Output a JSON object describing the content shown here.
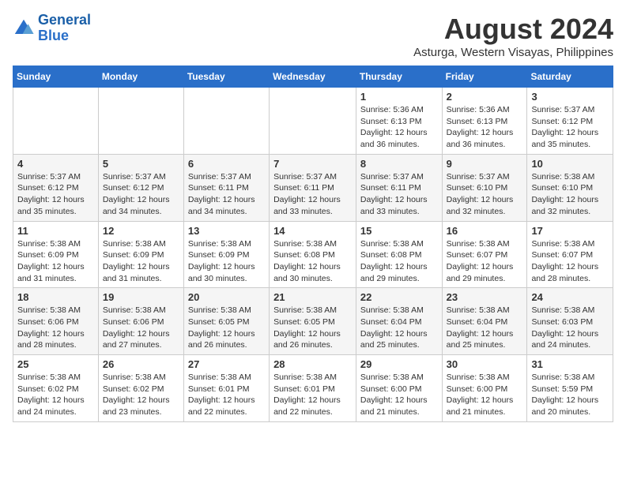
{
  "logo": {
    "line1": "General",
    "line2": "Blue"
  },
  "title": "August 2024",
  "location": "Asturga, Western Visayas, Philippines",
  "weekdays": [
    "Sunday",
    "Monday",
    "Tuesday",
    "Wednesday",
    "Thursday",
    "Friday",
    "Saturday"
  ],
  "weeks": [
    [
      {
        "day": "",
        "detail": ""
      },
      {
        "day": "",
        "detail": ""
      },
      {
        "day": "",
        "detail": ""
      },
      {
        "day": "",
        "detail": ""
      },
      {
        "day": "1",
        "detail": "Sunrise: 5:36 AM\nSunset: 6:13 PM\nDaylight: 12 hours\nand 36 minutes."
      },
      {
        "day": "2",
        "detail": "Sunrise: 5:36 AM\nSunset: 6:13 PM\nDaylight: 12 hours\nand 36 minutes."
      },
      {
        "day": "3",
        "detail": "Sunrise: 5:37 AM\nSunset: 6:12 PM\nDaylight: 12 hours\nand 35 minutes."
      }
    ],
    [
      {
        "day": "4",
        "detail": "Sunrise: 5:37 AM\nSunset: 6:12 PM\nDaylight: 12 hours\nand 35 minutes."
      },
      {
        "day": "5",
        "detail": "Sunrise: 5:37 AM\nSunset: 6:12 PM\nDaylight: 12 hours\nand 34 minutes."
      },
      {
        "day": "6",
        "detail": "Sunrise: 5:37 AM\nSunset: 6:11 PM\nDaylight: 12 hours\nand 34 minutes."
      },
      {
        "day": "7",
        "detail": "Sunrise: 5:37 AM\nSunset: 6:11 PM\nDaylight: 12 hours\nand 33 minutes."
      },
      {
        "day": "8",
        "detail": "Sunrise: 5:37 AM\nSunset: 6:11 PM\nDaylight: 12 hours\nand 33 minutes."
      },
      {
        "day": "9",
        "detail": "Sunrise: 5:37 AM\nSunset: 6:10 PM\nDaylight: 12 hours\nand 32 minutes."
      },
      {
        "day": "10",
        "detail": "Sunrise: 5:38 AM\nSunset: 6:10 PM\nDaylight: 12 hours\nand 32 minutes."
      }
    ],
    [
      {
        "day": "11",
        "detail": "Sunrise: 5:38 AM\nSunset: 6:09 PM\nDaylight: 12 hours\nand 31 minutes."
      },
      {
        "day": "12",
        "detail": "Sunrise: 5:38 AM\nSunset: 6:09 PM\nDaylight: 12 hours\nand 31 minutes."
      },
      {
        "day": "13",
        "detail": "Sunrise: 5:38 AM\nSunset: 6:09 PM\nDaylight: 12 hours\nand 30 minutes."
      },
      {
        "day": "14",
        "detail": "Sunrise: 5:38 AM\nSunset: 6:08 PM\nDaylight: 12 hours\nand 30 minutes."
      },
      {
        "day": "15",
        "detail": "Sunrise: 5:38 AM\nSunset: 6:08 PM\nDaylight: 12 hours\nand 29 minutes."
      },
      {
        "day": "16",
        "detail": "Sunrise: 5:38 AM\nSunset: 6:07 PM\nDaylight: 12 hours\nand 29 minutes."
      },
      {
        "day": "17",
        "detail": "Sunrise: 5:38 AM\nSunset: 6:07 PM\nDaylight: 12 hours\nand 28 minutes."
      }
    ],
    [
      {
        "day": "18",
        "detail": "Sunrise: 5:38 AM\nSunset: 6:06 PM\nDaylight: 12 hours\nand 28 minutes."
      },
      {
        "day": "19",
        "detail": "Sunrise: 5:38 AM\nSunset: 6:06 PM\nDaylight: 12 hours\nand 27 minutes."
      },
      {
        "day": "20",
        "detail": "Sunrise: 5:38 AM\nSunset: 6:05 PM\nDaylight: 12 hours\nand 26 minutes."
      },
      {
        "day": "21",
        "detail": "Sunrise: 5:38 AM\nSunset: 6:05 PM\nDaylight: 12 hours\nand 26 minutes."
      },
      {
        "day": "22",
        "detail": "Sunrise: 5:38 AM\nSunset: 6:04 PM\nDaylight: 12 hours\nand 25 minutes."
      },
      {
        "day": "23",
        "detail": "Sunrise: 5:38 AM\nSunset: 6:04 PM\nDaylight: 12 hours\nand 25 minutes."
      },
      {
        "day": "24",
        "detail": "Sunrise: 5:38 AM\nSunset: 6:03 PM\nDaylight: 12 hours\nand 24 minutes."
      }
    ],
    [
      {
        "day": "25",
        "detail": "Sunrise: 5:38 AM\nSunset: 6:02 PM\nDaylight: 12 hours\nand 24 minutes."
      },
      {
        "day": "26",
        "detail": "Sunrise: 5:38 AM\nSunset: 6:02 PM\nDaylight: 12 hours\nand 23 minutes."
      },
      {
        "day": "27",
        "detail": "Sunrise: 5:38 AM\nSunset: 6:01 PM\nDaylight: 12 hours\nand 22 minutes."
      },
      {
        "day": "28",
        "detail": "Sunrise: 5:38 AM\nSunset: 6:01 PM\nDaylight: 12 hours\nand 22 minutes."
      },
      {
        "day": "29",
        "detail": "Sunrise: 5:38 AM\nSunset: 6:00 PM\nDaylight: 12 hours\nand 21 minutes."
      },
      {
        "day": "30",
        "detail": "Sunrise: 5:38 AM\nSunset: 6:00 PM\nDaylight: 12 hours\nand 21 minutes."
      },
      {
        "day": "31",
        "detail": "Sunrise: 5:38 AM\nSunset: 5:59 PM\nDaylight: 12 hours\nand 20 minutes."
      }
    ]
  ]
}
